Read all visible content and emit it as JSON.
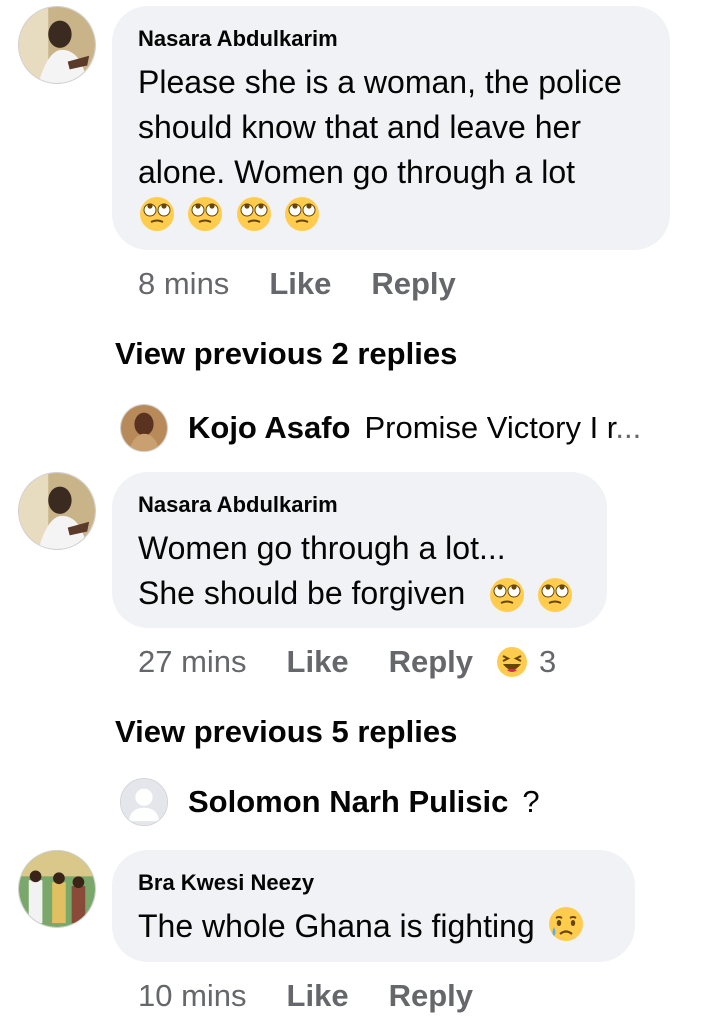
{
  "comments": [
    {
      "author": "Nasara Abdulkarim",
      "text": "Please she is a woman, the police\nshould know that and leave her\nalone. Women go through a lot",
      "emoji": "face-with-rolling-eyes x4",
      "time": "8 mins",
      "like_label": "Like",
      "reply_label": "Reply"
    },
    {
      "author": "Nasara Abdulkarim",
      "text": "Women go through a lot...\nShe should be forgiven",
      "emoji": "face-with-rolling-eyes x2",
      "time": "27 mins",
      "like_label": "Like",
      "reply_label": "Reply",
      "reaction": {
        "icon": "haha-reaction-icon",
        "count": "3"
      }
    },
    {
      "author": "Bra Kwesi Neezy",
      "text": "The whole Ghana is fighting",
      "emoji": "crying-face",
      "time": "10 mins",
      "like_label": "Like",
      "reply_label": "Reply"
    }
  ],
  "view_previous": [
    {
      "label": "View previous 2 replies"
    },
    {
      "label": "View previous 5 replies"
    }
  ],
  "reply_previews": [
    {
      "name": "Kojo Asafo",
      "text": "Promise Victory I r",
      "ellipsis": "..."
    },
    {
      "name": "Solomon Narh Pulisic",
      "text": "?"
    }
  ],
  "colors": {
    "bubble": "#f0f2f5",
    "secondary_text": "#65676b",
    "primary_text": "#050505"
  }
}
